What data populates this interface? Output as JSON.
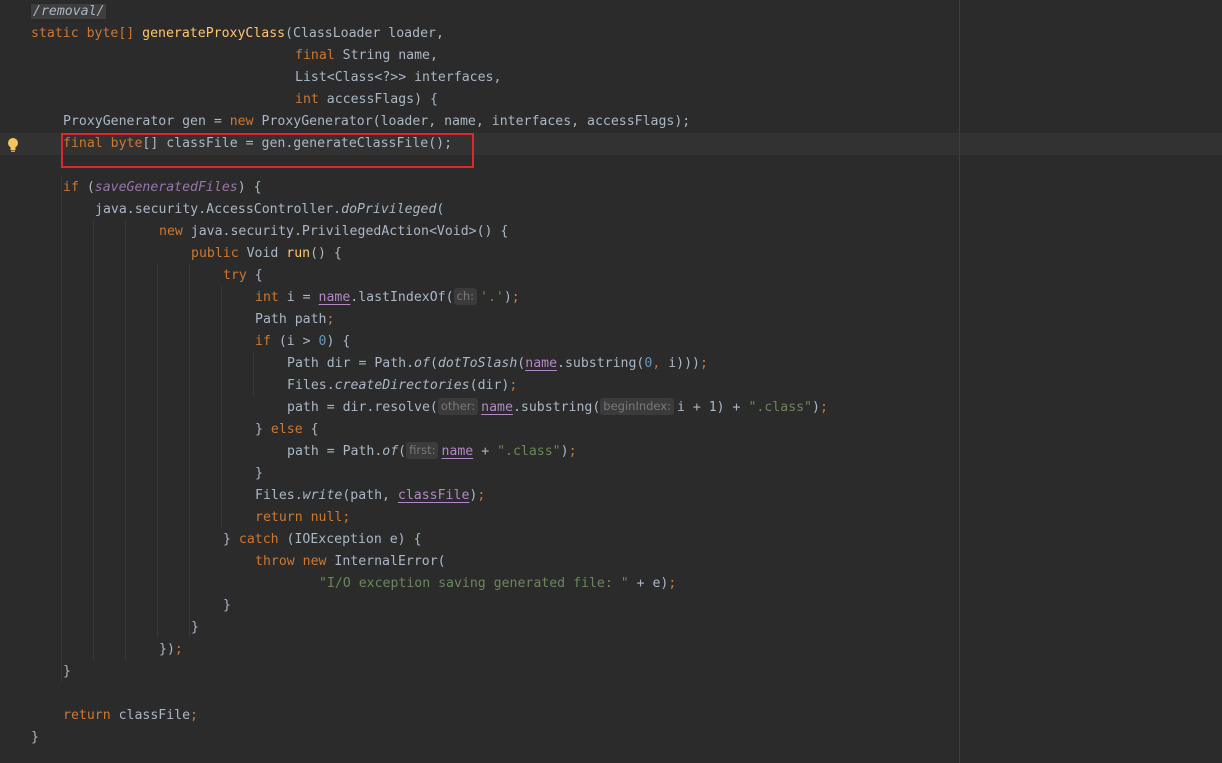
{
  "editor": {
    "doc_path": "/removal/",
    "method_signature": {
      "modifiers": "static byte[]",
      "name": "generateProxyClass",
      "param1": "(ClassLoader loader,",
      "param2_kw": "final",
      "param2": " String name,",
      "param3": "List<Class<?>> interfaces,",
      "param4_kw": "int",
      "param4": " accessFlags) {"
    },
    "line_gen_a": "ProxyGenerator gen = ",
    "line_gen_kw": "new",
    "line_gen_b": " ProxyGenerator(loader, name, interfaces, accessFlags);",
    "line_classfile_kw": "final byte",
    "line_classfile": "[] classFile = gen.generateClassFile();",
    "if_kw": "if",
    "if_field": "saveGeneratedFiles",
    "do_priv_a": "java.security.AccessController.",
    "do_priv_b": "doPrivileged",
    "new_action_kw": "new",
    "new_action": " java.security.PrivilegedAction<Void>() {",
    "run_kw": "public",
    "run_type": " Void ",
    "run_name": "run",
    "try_kw": "try",
    "int_kw": "int",
    "int_decl": " i = ",
    "name_var": "name",
    "last_index": ".lastIndexOf(",
    "hint_ch": "ch:",
    "char_dot": "'.'",
    "path_decl": "Path path",
    "if2_kw": "if",
    "if2_cond": " (i > ",
    "zero": "0",
    "path_dir_a": "Path dir = Path.",
    "of_name": "of",
    "dot_to_slash": "dotToSlash",
    "substring": ".substring(",
    "files_a": "Files.",
    "create_dirs": "createDirectories",
    "create_dirs_arg": "(dir)",
    "resolve_a": "path = dir.resolve(",
    "hint_other": "other:",
    "hint_begin": "beginIndex:",
    "resolve_b": "i + 1) + ",
    "class_str": "\".class\"",
    "else_kw": "else",
    "path_of_a": "path = Path.",
    "hint_first": "first:",
    "plus": " + ",
    "write_name": "write",
    "write_arg": "(path, ",
    "class_file_var": "classFile",
    "return_kw": "return",
    "null_kw": "null",
    "catch_kw": "catch",
    "catch_arg": " (IOException e) {",
    "throw_kw": "throw",
    "throw_new_kw": "new",
    "internal_error": " InternalError(",
    "io_msg": "\"I/O exception saving generated file: \"",
    "io_tail": " + e)",
    "close_lambda": "})",
    "return_final": " classFile"
  },
  "colors": {
    "background": "#2b2b2b",
    "keyword": "#cc7832",
    "method": "#ffc66d",
    "string": "#6a8759",
    "number": "#6897bb",
    "field": "#9876aa",
    "highlight_box": "#e0262b"
  }
}
